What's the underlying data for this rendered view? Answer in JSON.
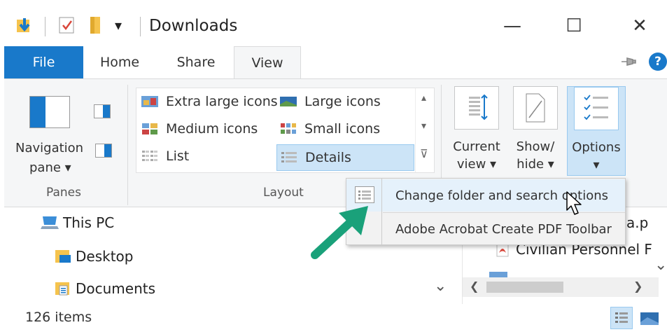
{
  "window": {
    "title": "Downloads",
    "minimize_glyph": "—",
    "maximize_glyph": "☐",
    "close_glyph": "✕",
    "qa_dropdown_glyph": "▾"
  },
  "tabs": {
    "file": "File",
    "home": "Home",
    "share": "Share",
    "view": "View"
  },
  "help_glyph": "?",
  "ribbon": {
    "panes": {
      "nav_line1": "Navigation",
      "nav_line2": "pane ▾",
      "group": "Panes"
    },
    "layout": {
      "group": "Layout",
      "items": [
        "Extra large icons",
        "Large icons",
        "Medium icons",
        "Small icons",
        "List",
        "Details"
      ],
      "scroll_up": "▴",
      "scroll_down": "▾",
      "scroll_more": "⊽"
    },
    "current_view": {
      "line1": "Current",
      "line2": "view ▾"
    },
    "show_hide": {
      "line1": "Show/",
      "line2": "hide ▾"
    },
    "options": {
      "line1": "Options",
      "line2": "▾"
    }
  },
  "menu": {
    "items": [
      "Change folder and search options",
      "Adobe Acrobat Create PDF Toolbar"
    ]
  },
  "nav": {
    "items": [
      "This PC",
      "Desktop",
      "Documents"
    ],
    "chevron": "⌄"
  },
  "files": {
    "items": [
      "a.p",
      "Civilian Personnel F"
    ],
    "scroll_left": "❮",
    "scroll_right": "❯",
    "scroll_down": "⌄"
  },
  "status": {
    "count": "126 items"
  },
  "colors": {
    "accent": "#1979ca",
    "arrow": "#1aa17a"
  }
}
